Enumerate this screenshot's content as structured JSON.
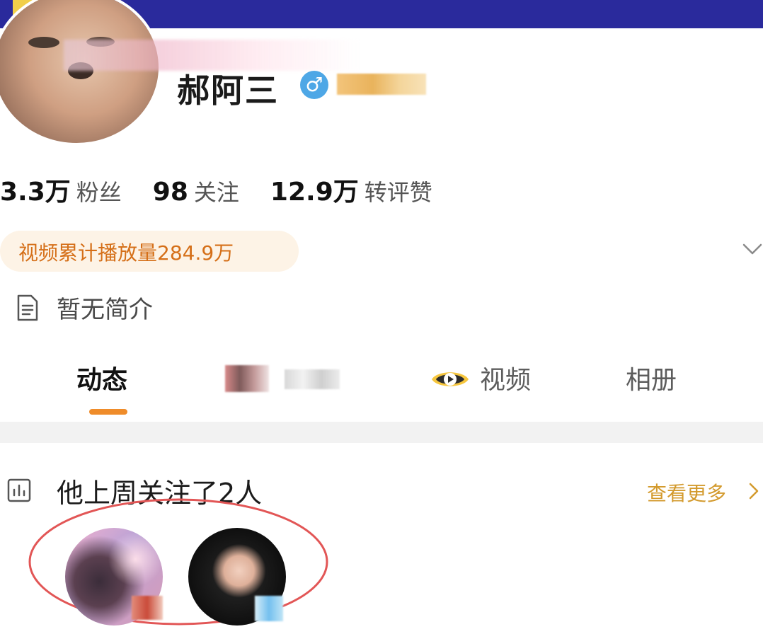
{
  "profile": {
    "username": "郝阿三",
    "gender_icon": "male-icon",
    "gender_symbol": "♂"
  },
  "stats": [
    {
      "value": "3.3万",
      "label": "粉丝"
    },
    {
      "value": "98",
      "label": "关注"
    },
    {
      "value": "12.9万",
      "label": "转评赞"
    }
  ],
  "badges": {
    "play_count": "视频累计播放量284.9万"
  },
  "bio": {
    "text": "暂无简介",
    "icon": "document-icon"
  },
  "tabs": [
    {
      "label": "动态",
      "active": true
    },
    {
      "label": "视频",
      "icon": "video-icon"
    },
    {
      "label": "相册"
    }
  ],
  "follow_section": {
    "title": "他上周关注了2人",
    "see_more": "查看更多",
    "icon": "chart-icon"
  },
  "colors": {
    "accent": "#ef8c2a",
    "top_bar": "#2a2a9c",
    "highlight_circle": "#e25656",
    "see_more": "#d39a2d"
  }
}
